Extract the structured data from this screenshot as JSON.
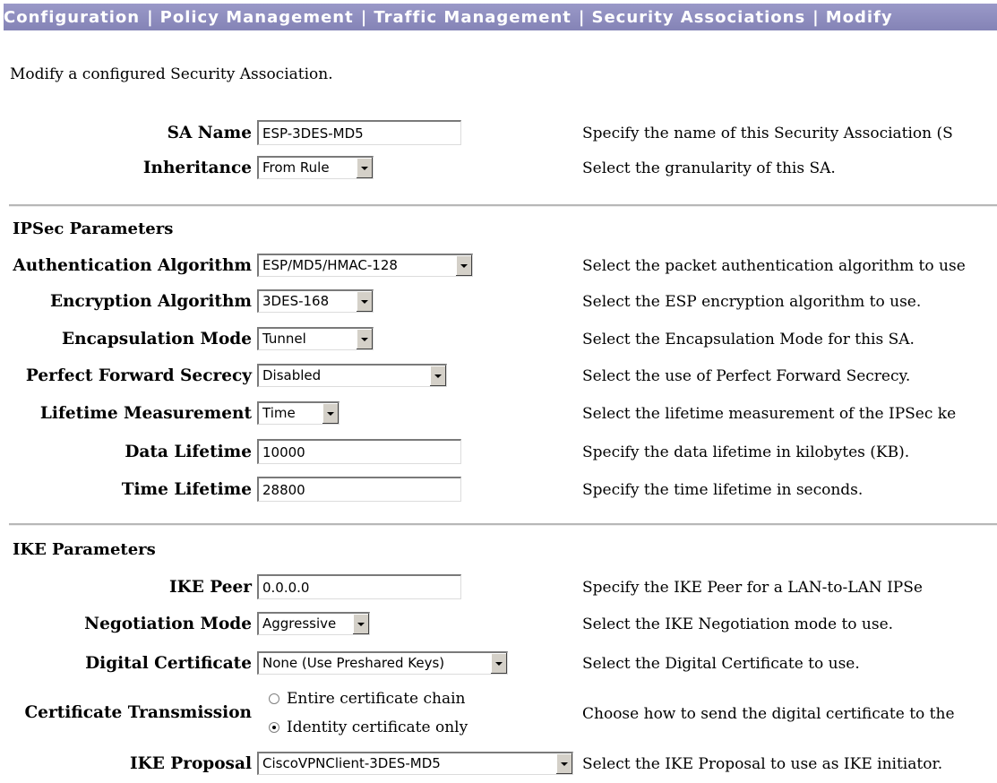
{
  "breadcrumb": {
    "items": [
      "Configuration",
      "Policy Management",
      "Traffic Management",
      "Security Associations",
      "Modify"
    ],
    "separator": "|"
  },
  "intro": "Modify a configured Security Association.",
  "sa_name": {
    "label": "SA Name",
    "value": "ESP-3DES-MD5",
    "desc": "Specify the name of this Security Association (S"
  },
  "inheritance": {
    "label": "Inheritance",
    "value": "From Rule",
    "desc": "Select the granularity of this SA."
  },
  "ipsec": {
    "title": "IPSec Parameters",
    "auth_alg": {
      "label": "Authentication Algorithm",
      "value": "ESP/MD5/HMAC-128",
      "desc": "Select the packet authentication algorithm to use"
    },
    "enc_alg": {
      "label": "Encryption Algorithm",
      "value": "3DES-168",
      "desc": "Select the ESP encryption algorithm to use."
    },
    "encap_mode": {
      "label": "Encapsulation Mode",
      "value": "Tunnel",
      "desc": "Select the Encapsulation Mode for this SA."
    },
    "pfs": {
      "label": "Perfect Forward Secrecy",
      "value": "Disabled",
      "desc": "Select the use of Perfect Forward Secrecy."
    },
    "lifetime_measurement": {
      "label": "Lifetime Measurement",
      "value": "Time",
      "desc": "Select the lifetime measurement of the IPSec ke"
    },
    "data_lifetime": {
      "label": "Data Lifetime",
      "value": "10000",
      "desc": "Specify the data lifetime in kilobytes (KB)."
    },
    "time_lifetime": {
      "label": "Time Lifetime",
      "value": "28800",
      "desc": "Specify the time lifetime in seconds."
    }
  },
  "ike": {
    "title": "IKE Parameters",
    "peer": {
      "label": "IKE Peer",
      "value": "0.0.0.0",
      "desc": "Specify the IKE Peer for a LAN-to-LAN IPSe"
    },
    "negotiation_mode": {
      "label": "Negotiation Mode",
      "value": "Aggressive",
      "desc": "Select the IKE Negotiation mode to use."
    },
    "digital_cert": {
      "label": "Digital Certificate",
      "value": "None (Use Preshared Keys)",
      "desc": "Select the Digital Certificate to use."
    },
    "cert_transmission": {
      "label": "Certificate Transmission",
      "options": [
        "Entire certificate chain",
        "Identity certificate only"
      ],
      "selected": "Identity certificate only",
      "desc": "Choose how to send the digital certificate to the"
    },
    "proposal": {
      "label": "IKE Proposal",
      "value": "CiscoVPNClient-3DES-MD5",
      "desc": "Select the IKE Proposal to use as IKE initiator."
    }
  }
}
